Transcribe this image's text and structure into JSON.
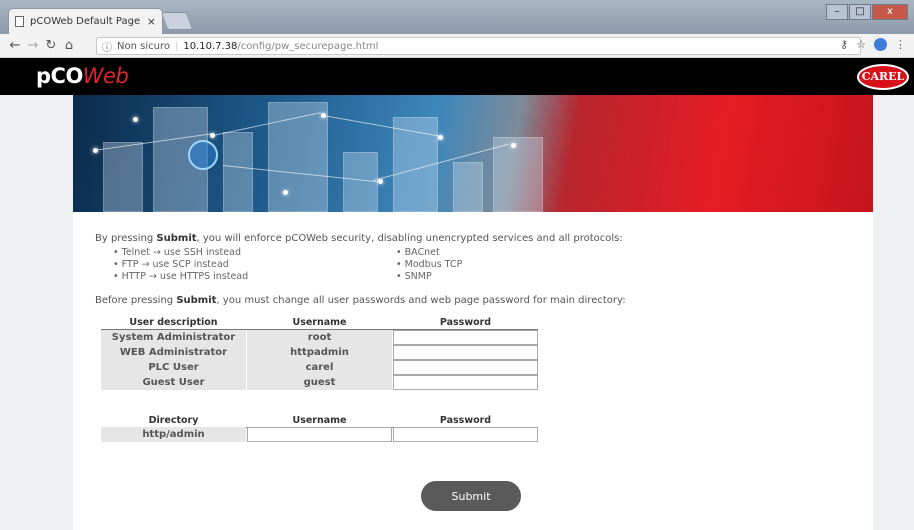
{
  "browser": {
    "tab_title": "pCOWeb Default Page",
    "tab_close": "×",
    "security_label": "Non sicuro",
    "url_host": "10.10.7.38",
    "url_path": "/config/pw_securepage.html",
    "win_min": "–",
    "win_max": "□",
    "win_close": "x"
  },
  "header": {
    "logo_pco": "pCO",
    "logo_web": "Web",
    "brand": "CAREL"
  },
  "intro": {
    "prefix": "By pressing ",
    "submit_word": "Submit",
    "suffix": ", you will enforce pCOWeb security, disabling unencrypted services and all protocols:",
    "left_bullets": [
      "Telnet → use SSH instead",
      "FTP → use SCP instead",
      "HTTP → use HTTPS instead"
    ],
    "right_bullets": [
      "BACnet",
      "Modbus TCP",
      "SNMP"
    ]
  },
  "before": {
    "prefix": "Before pressing ",
    "submit_word": "Submit",
    "suffix": ", you must change all user passwords and web page password for main directory:"
  },
  "users_table": {
    "headers": [
      "User description",
      "Username",
      "Password"
    ],
    "rows": [
      {
        "description": "System Administrator",
        "username": "root"
      },
      {
        "description": "WEB Administrator",
        "username": "httpadmin"
      },
      {
        "description": "PLC User",
        "username": "carel"
      },
      {
        "description": "Guest User",
        "username": "guest"
      }
    ]
  },
  "directory_table": {
    "headers": [
      "Directory",
      "Username",
      "Password"
    ],
    "row": {
      "directory": "http/admin"
    }
  },
  "submit_label": "Submit"
}
